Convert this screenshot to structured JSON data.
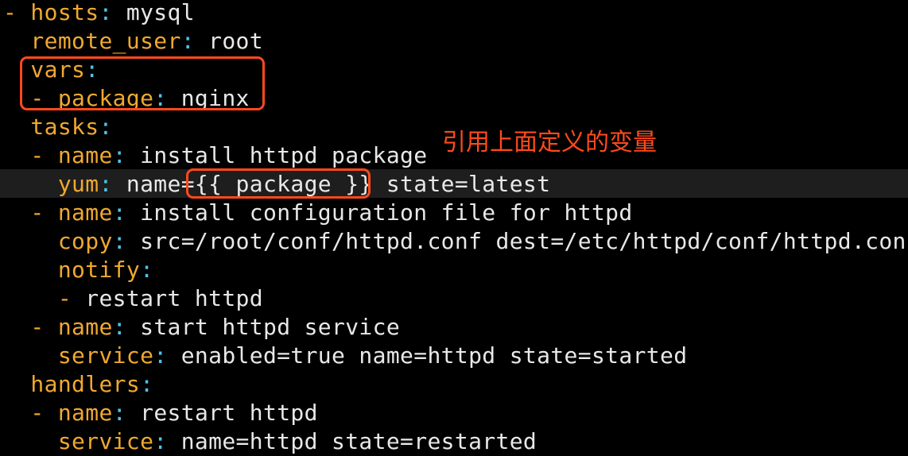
{
  "colors": {
    "background": "#000000",
    "key": "#f0a830",
    "colon": "#4fc3e8",
    "value": "#e8e8e8",
    "highlight": "#ff4a1c",
    "cursor_line": "#1e1e1e"
  },
  "lines": [
    {
      "indent": "",
      "dash": "- ",
      "key": "hosts",
      "colon": ":",
      "value": " mysql"
    },
    {
      "indent": "  ",
      "dash": "",
      "key": "remote_user",
      "colon": ":",
      "value": " root"
    },
    {
      "indent": "  ",
      "dash": "",
      "key": "vars",
      "colon": ":",
      "value": ""
    },
    {
      "indent": "  ",
      "dash": "- ",
      "key": "package",
      "colon": ":",
      "value": " nginx"
    },
    {
      "indent": "  ",
      "dash": "",
      "key": "tasks",
      "colon": ":",
      "value": ""
    },
    {
      "indent": "  ",
      "dash": "- ",
      "key": "name",
      "colon": ":",
      "value": " install httpd package"
    },
    {
      "indent": "    ",
      "dash": "",
      "key": "yum",
      "colon": ":",
      "value": " name={{ package }} state=latest"
    },
    {
      "indent": "  ",
      "dash": "- ",
      "key": "name",
      "colon": ":",
      "value": " install configuration file for httpd"
    },
    {
      "indent": "    ",
      "dash": "",
      "key": "copy",
      "colon": ":",
      "value": " src=/root/conf/httpd.conf dest=/etc/httpd/conf/httpd.conf"
    },
    {
      "indent": "    ",
      "dash": "",
      "key": "notify",
      "colon": ":",
      "value": ""
    },
    {
      "indent": "    ",
      "dash": "- ",
      "key": "",
      "colon": "",
      "value": "restart httpd"
    },
    {
      "indent": "  ",
      "dash": "- ",
      "key": "name",
      "colon": ":",
      "value": " start httpd service"
    },
    {
      "indent": "    ",
      "dash": "",
      "key": "service",
      "colon": ":",
      "value": " enabled=true name=httpd state=started"
    },
    {
      "indent": "  ",
      "dash": "",
      "key": "handlers",
      "colon": ":",
      "value": ""
    },
    {
      "indent": "  ",
      "dash": "- ",
      "key": "name",
      "colon": ":",
      "value": " restart httpd"
    },
    {
      "indent": "    ",
      "dash": "",
      "key": "service",
      "colon": ":",
      "value": " name=httpd state=restarted"
    }
  ],
  "annotation": {
    "text": "引用上面定义的变量"
  }
}
